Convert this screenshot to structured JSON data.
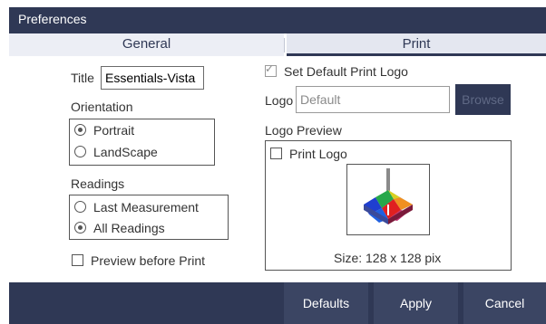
{
  "window": {
    "title": "Preferences"
  },
  "tabs": [
    {
      "label": "General"
    },
    {
      "label": "Print"
    }
  ],
  "left": {
    "title_label": "Title",
    "title_value": "Essentials-Vista",
    "orientation_label": "Orientation",
    "orientation_options": [
      {
        "label": "Portrait",
        "selected": true
      },
      {
        "label": "LandScape",
        "selected": false
      }
    ],
    "readings_label": "Readings",
    "readings_options": [
      {
        "label": "Last Measurement",
        "selected": false
      },
      {
        "label": "All Readings",
        "selected": true
      }
    ],
    "preview_before_print_label": "Preview before Print",
    "preview_before_print_checked": false
  },
  "right": {
    "set_default_print_logo_label": "Set Default Print Logo",
    "set_default_print_logo_checked": true,
    "logo_label": "Logo",
    "logo_placeholder": "Default",
    "browse_label": "Browse",
    "logo_preview_label": "Logo Preview",
    "print_logo_label": "Print Logo",
    "print_logo_checked": false,
    "logo_icon": "color-chart-logo",
    "size_text": "Size: 128 x 128 pix"
  },
  "footer": {
    "defaults_label": "Defaults",
    "apply_label": "Apply",
    "cancel_label": "Cancel"
  },
  "colors": {
    "accent": "#2f3855",
    "tab_bg": "#eceef5",
    "button_bg": "#3b4563"
  }
}
